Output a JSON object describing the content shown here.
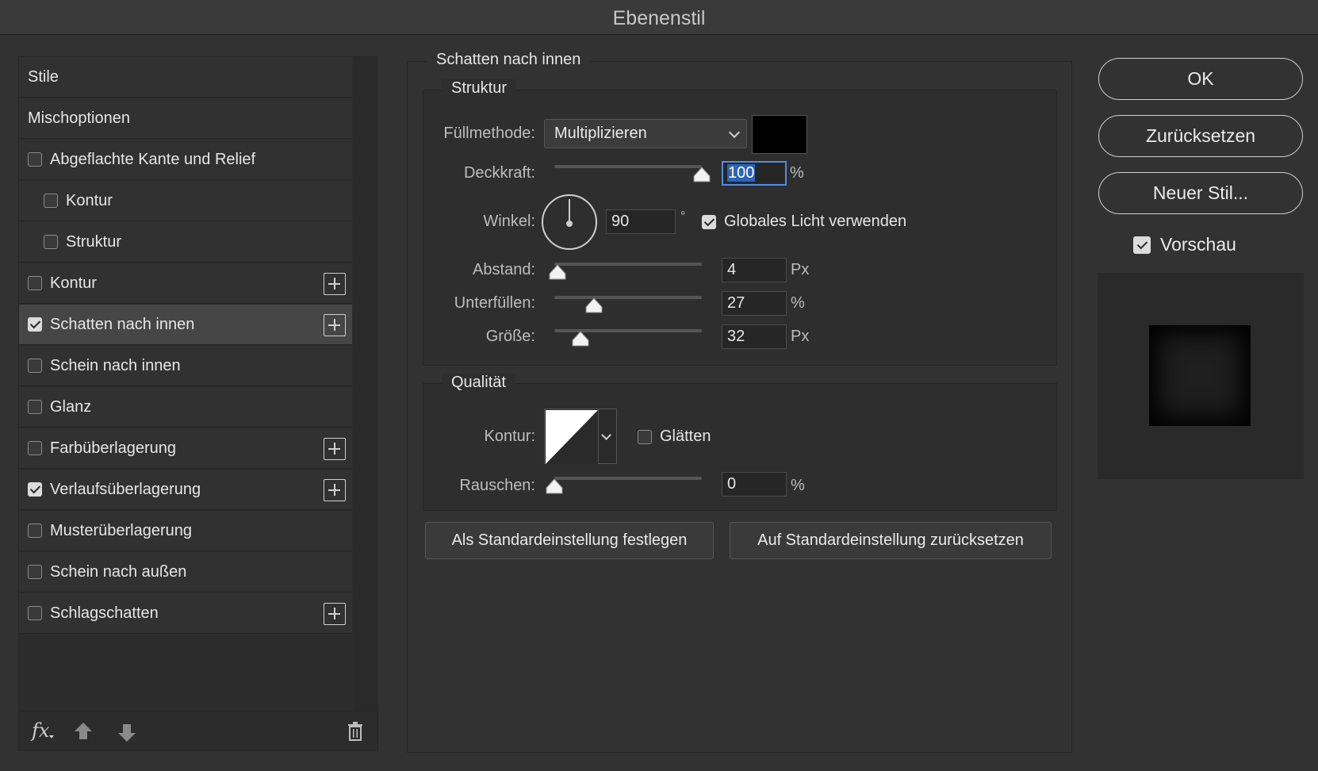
{
  "window": {
    "title": "Ebenenstil"
  },
  "styles_list": {
    "items": [
      {
        "label": "Stile",
        "type": "header",
        "checked": null,
        "plus": false,
        "selected": false
      },
      {
        "label": "Mischoptionen",
        "type": "header",
        "checked": null,
        "plus": false,
        "selected": false
      },
      {
        "label": "Abgeflachte Kante und Relief",
        "type": "check",
        "checked": false,
        "plus": false,
        "selected": false
      },
      {
        "label": "Kontur",
        "type": "sub",
        "checked": false,
        "plus": false,
        "selected": false
      },
      {
        "label": "Struktur",
        "type": "sub",
        "checked": false,
        "plus": false,
        "selected": false
      },
      {
        "label": "Kontur",
        "type": "check",
        "checked": false,
        "plus": true,
        "selected": false
      },
      {
        "label": "Schatten nach innen",
        "type": "check",
        "checked": true,
        "plus": true,
        "selected": true
      },
      {
        "label": "Schein nach innen",
        "type": "check",
        "checked": false,
        "plus": false,
        "selected": false
      },
      {
        "label": "Glanz",
        "type": "check",
        "checked": false,
        "plus": false,
        "selected": false
      },
      {
        "label": "Farbüberlagerung",
        "type": "check",
        "checked": false,
        "plus": true,
        "selected": false
      },
      {
        "label": "Verlaufsüberlagerung",
        "type": "check",
        "checked": true,
        "plus": true,
        "selected": false
      },
      {
        "label": "Musterüberlagerung",
        "type": "check",
        "checked": false,
        "plus": false,
        "selected": false
      },
      {
        "label": "Schein nach außen",
        "type": "check",
        "checked": false,
        "plus": false,
        "selected": false
      },
      {
        "label": "Schlagschatten",
        "type": "check",
        "checked": false,
        "plus": true,
        "selected": false
      }
    ],
    "footer": {
      "fx_label": "fx"
    }
  },
  "inner_shadow": {
    "group_title": "Schatten nach innen",
    "structure": {
      "title": "Struktur",
      "blend_mode": {
        "label": "Füllmethode:",
        "value": "Multiplizieren"
      },
      "color": "#000000",
      "opacity": {
        "label": "Deckkraft:",
        "value": "100",
        "unit": "%",
        "fraction": 1.0
      },
      "angle": {
        "label": "Winkel:",
        "value": "90",
        "unit": "°"
      },
      "global_light": {
        "label": "Globales Licht verwenden",
        "checked": true
      },
      "distance": {
        "label": "Abstand:",
        "value": "4",
        "unit": "Px",
        "fraction": 0.02
      },
      "choke": {
        "label": "Unterfüllen:",
        "value": "27",
        "unit": "%",
        "fraction": 0.27
      },
      "size": {
        "label": "Größe:",
        "value": "32",
        "unit": "Px",
        "fraction": 0.18
      }
    },
    "quality": {
      "title": "Qualität",
      "contour": {
        "label": "Kontur:"
      },
      "antialias": {
        "label": "Glätten",
        "checked": false
      },
      "noise": {
        "label": "Rauschen:",
        "value": "0",
        "unit": "%",
        "fraction": 0.0
      }
    },
    "buttons": {
      "make_default": "Als Standardeinstellung festlegen",
      "reset_default": "Auf Standardeinstellung zurücksetzen"
    }
  },
  "right": {
    "ok": "OK",
    "reset": "Zurücksetzen",
    "new_style": "Neuer Stil...",
    "preview": {
      "label": "Vorschau",
      "checked": true
    }
  }
}
